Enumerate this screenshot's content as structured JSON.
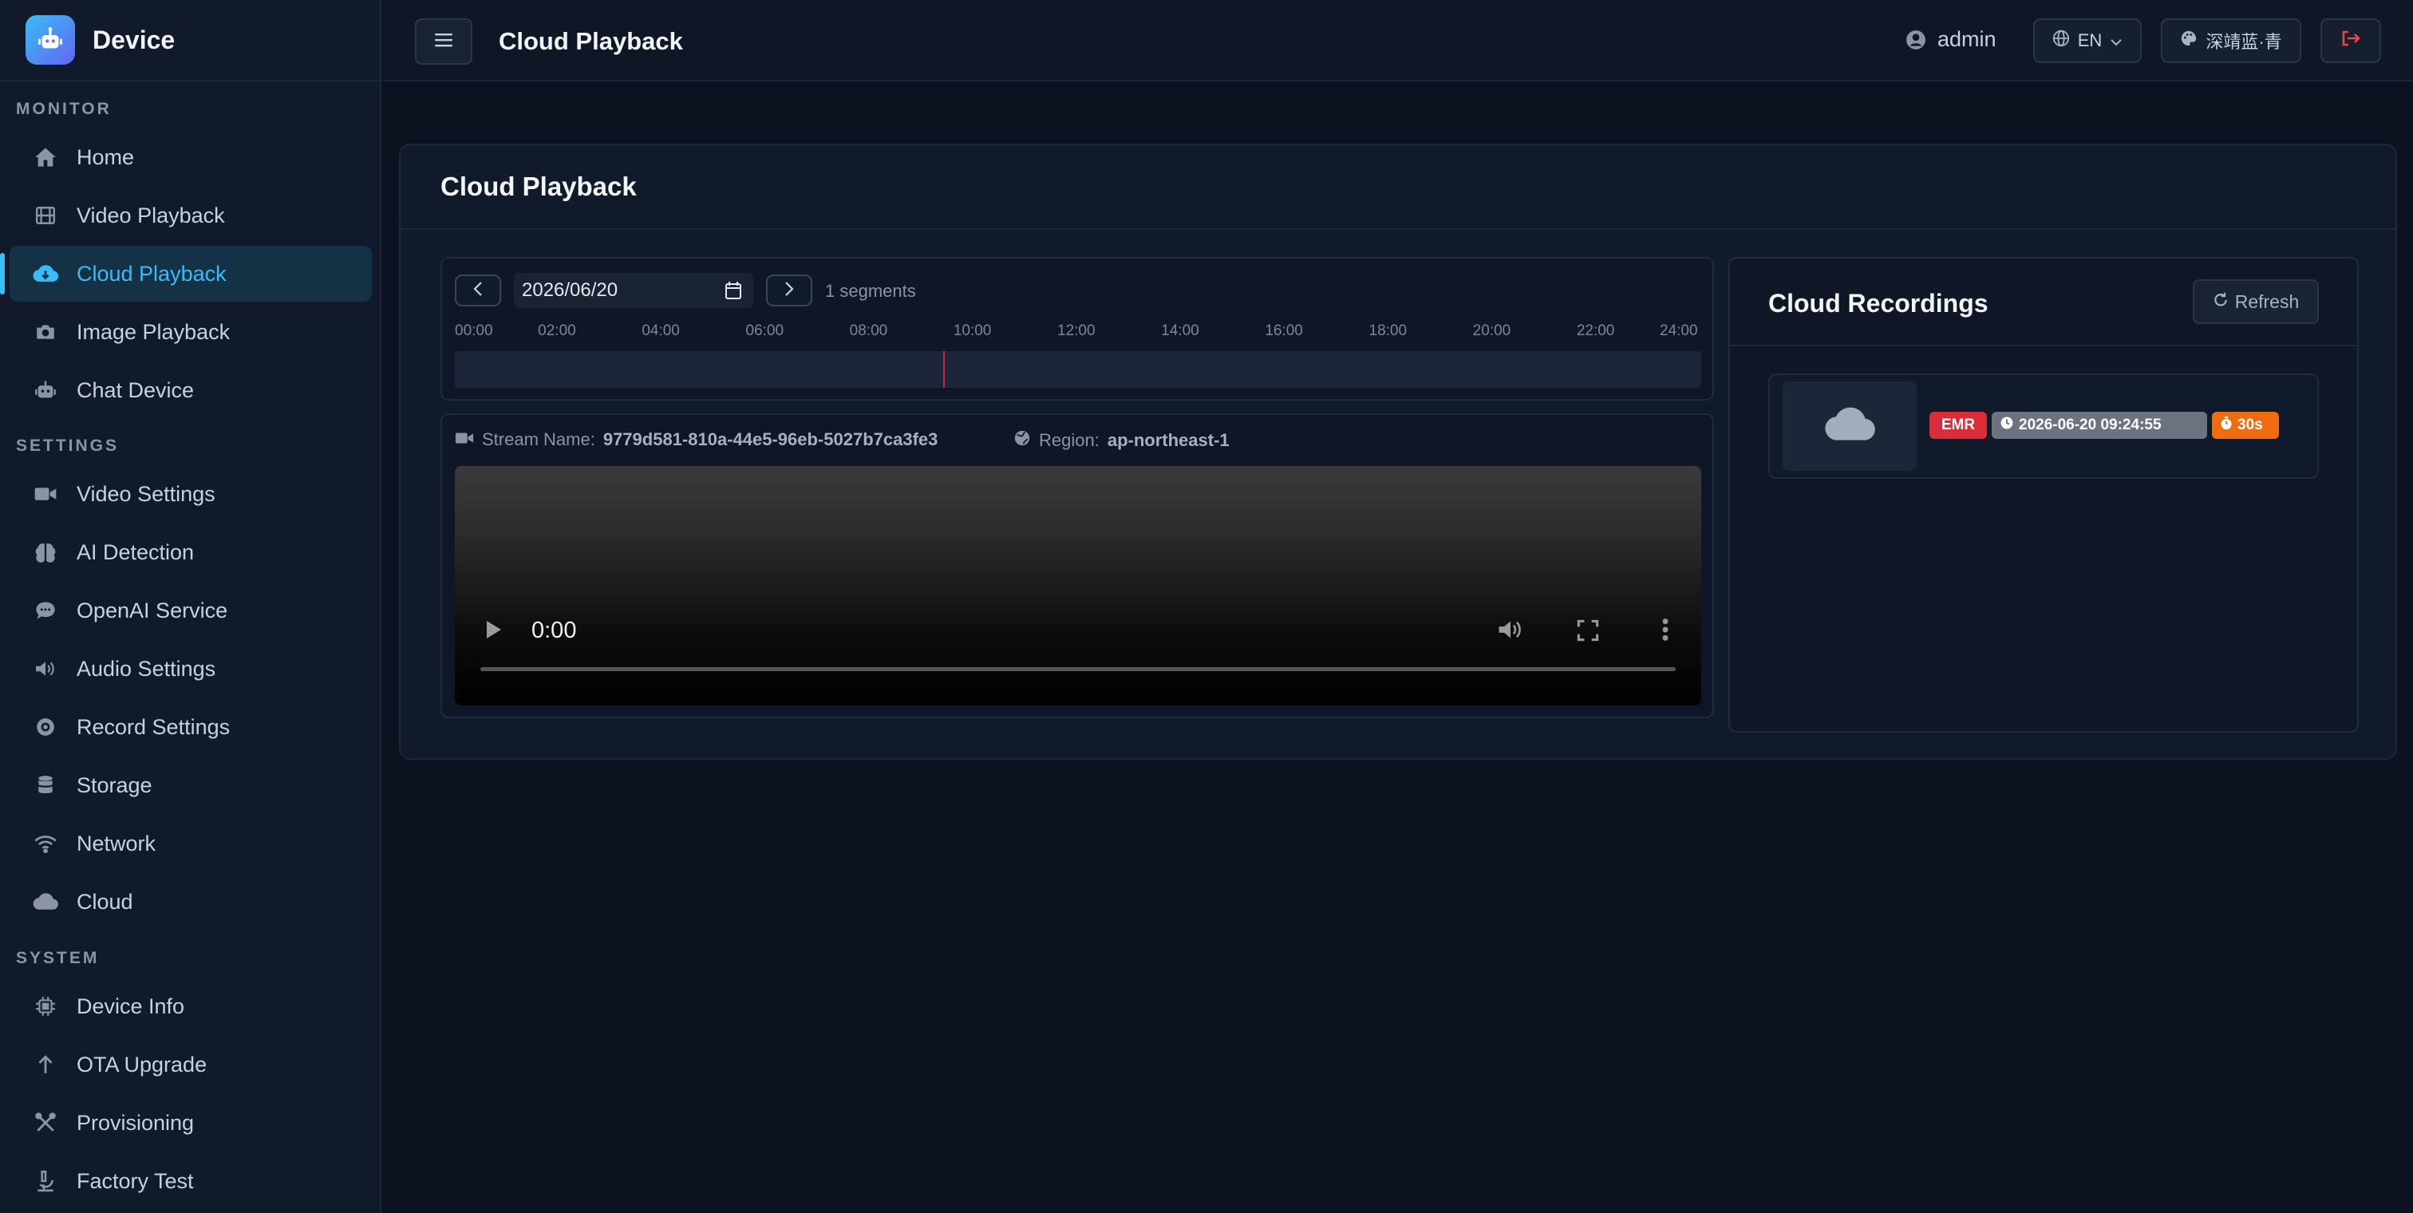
{
  "app": {
    "name": "Device",
    "logo_icon": "robot-icon"
  },
  "sidebar": {
    "sections": [
      {
        "label": "MONITOR"
      },
      {
        "label": "SETTINGS"
      },
      {
        "label": "SYSTEM"
      }
    ],
    "items": [
      {
        "label": "Home",
        "icon": "home-icon"
      },
      {
        "label": "Video Playback",
        "icon": "film-icon"
      },
      {
        "label": "Cloud Playback",
        "icon": "cloud-download-icon",
        "active": true
      },
      {
        "label": "Image Playback",
        "icon": "camera-icon"
      },
      {
        "label": "Chat Device",
        "icon": "robot-icon"
      },
      {
        "label": "Video Settings",
        "icon": "video-icon"
      },
      {
        "label": "AI Detection",
        "icon": "brain-icon"
      },
      {
        "label": "OpenAI Service",
        "icon": "chat-bubble-icon"
      },
      {
        "label": "Audio Settings",
        "icon": "volume-icon"
      },
      {
        "label": "Record Settings",
        "icon": "record-icon"
      },
      {
        "label": "Storage",
        "icon": "database-icon"
      },
      {
        "label": "Network",
        "icon": "wifi-icon"
      },
      {
        "label": "Cloud",
        "icon": "cloud-icon"
      },
      {
        "label": "Device Info",
        "icon": "chip-icon"
      },
      {
        "label": "OTA Upgrade",
        "icon": "arrow-up-icon"
      },
      {
        "label": "Provisioning",
        "icon": "tools-icon"
      },
      {
        "label": "Factory Test",
        "icon": "microscope-icon"
      }
    ]
  },
  "topbar": {
    "title": "Cloud Playback",
    "user": "admin",
    "language": "EN",
    "theme": "深靖蓝·青"
  },
  "card": {
    "title": "Cloud Playback"
  },
  "timeline": {
    "date": "2026/06/20",
    "segments_text": "1 segments",
    "ticks": [
      "00:00",
      "02:00",
      "04:00",
      "06:00",
      "08:00",
      "10:00",
      "12:00",
      "14:00",
      "16:00",
      "18:00",
      "20:00",
      "22:00",
      "24:00"
    ],
    "marker_time": "09:24",
    "marker_fraction": 0.392
  },
  "player": {
    "stream_label": "Stream Name:",
    "stream_name": "9779d581-810a-44e5-96eb-5027b7ca3fe3",
    "region_label": "Region:",
    "region": "ap-northeast-1",
    "current_time": "0:00"
  },
  "recordings": {
    "title": "Cloud Recordings",
    "refresh_label": "Refresh",
    "items": [
      {
        "type_badge": "EMR",
        "timestamp": "2026-06-20 09:24:55",
        "duration": "30s",
        "thumbnail_icon": "cloud-icon"
      }
    ]
  },
  "colors": {
    "accent": "#38bdf8",
    "background": "#0c1220",
    "panel": "#111a2b",
    "emr_badge": "#d92d3a",
    "duration_badge": "#ef6c11",
    "time_badge": "#6b7280"
  }
}
